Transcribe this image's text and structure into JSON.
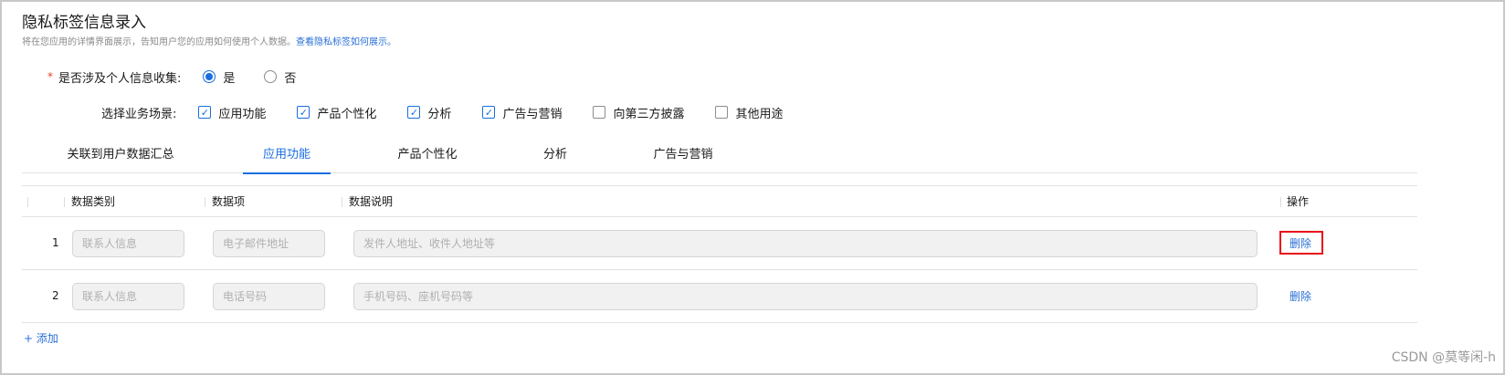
{
  "header": {
    "title": "隐私标签信息录入",
    "description": "将在您应用的详情界面展示，告知用户您的应用如何使用个人数据。",
    "description_link": "查看隐私标签如何展示。"
  },
  "collect": {
    "required_mark": "*",
    "label": "是否涉及个人信息收集:",
    "options": [
      {
        "label": "是",
        "selected": true
      },
      {
        "label": "否",
        "selected": false
      }
    ]
  },
  "scene": {
    "label": "选择业务场景:",
    "options": [
      {
        "label": "应用功能",
        "checked": true
      },
      {
        "label": "产品个性化",
        "checked": true
      },
      {
        "label": "分析",
        "checked": true
      },
      {
        "label": "广告与营销",
        "checked": true
      },
      {
        "label": "向第三方披露",
        "checked": false
      },
      {
        "label": "其他用途",
        "checked": false
      }
    ]
  },
  "tabs": [
    {
      "label": "关联到用户数据汇总",
      "active": false
    },
    {
      "label": "应用功能",
      "active": true
    },
    {
      "label": "产品个性化",
      "active": false
    },
    {
      "label": "分析",
      "active": false
    },
    {
      "label": "广告与营销",
      "active": false
    }
  ],
  "table": {
    "headers": {
      "category": "数据类别",
      "item": "数据项",
      "desc": "数据说明",
      "action": "操作"
    },
    "rows": [
      {
        "index": "1",
        "category_placeholder": "联系人信息",
        "item_placeholder": "电子邮件地址",
        "desc_placeholder": "发件人地址、收件人地址等",
        "action": "删除"
      },
      {
        "index": "2",
        "category_placeholder": "联系人信息",
        "item_placeholder": "电话号码",
        "desc_placeholder": "手机号码、座机号码等",
        "action": "删除"
      }
    ]
  },
  "add_label": "+ 添加",
  "watermark": "CSDN @莫等闲-h",
  "colors": {
    "accent": "#1a6ee0",
    "link": "#2a6fd6",
    "required": "#e84026",
    "highlight": "#e8101a"
  }
}
